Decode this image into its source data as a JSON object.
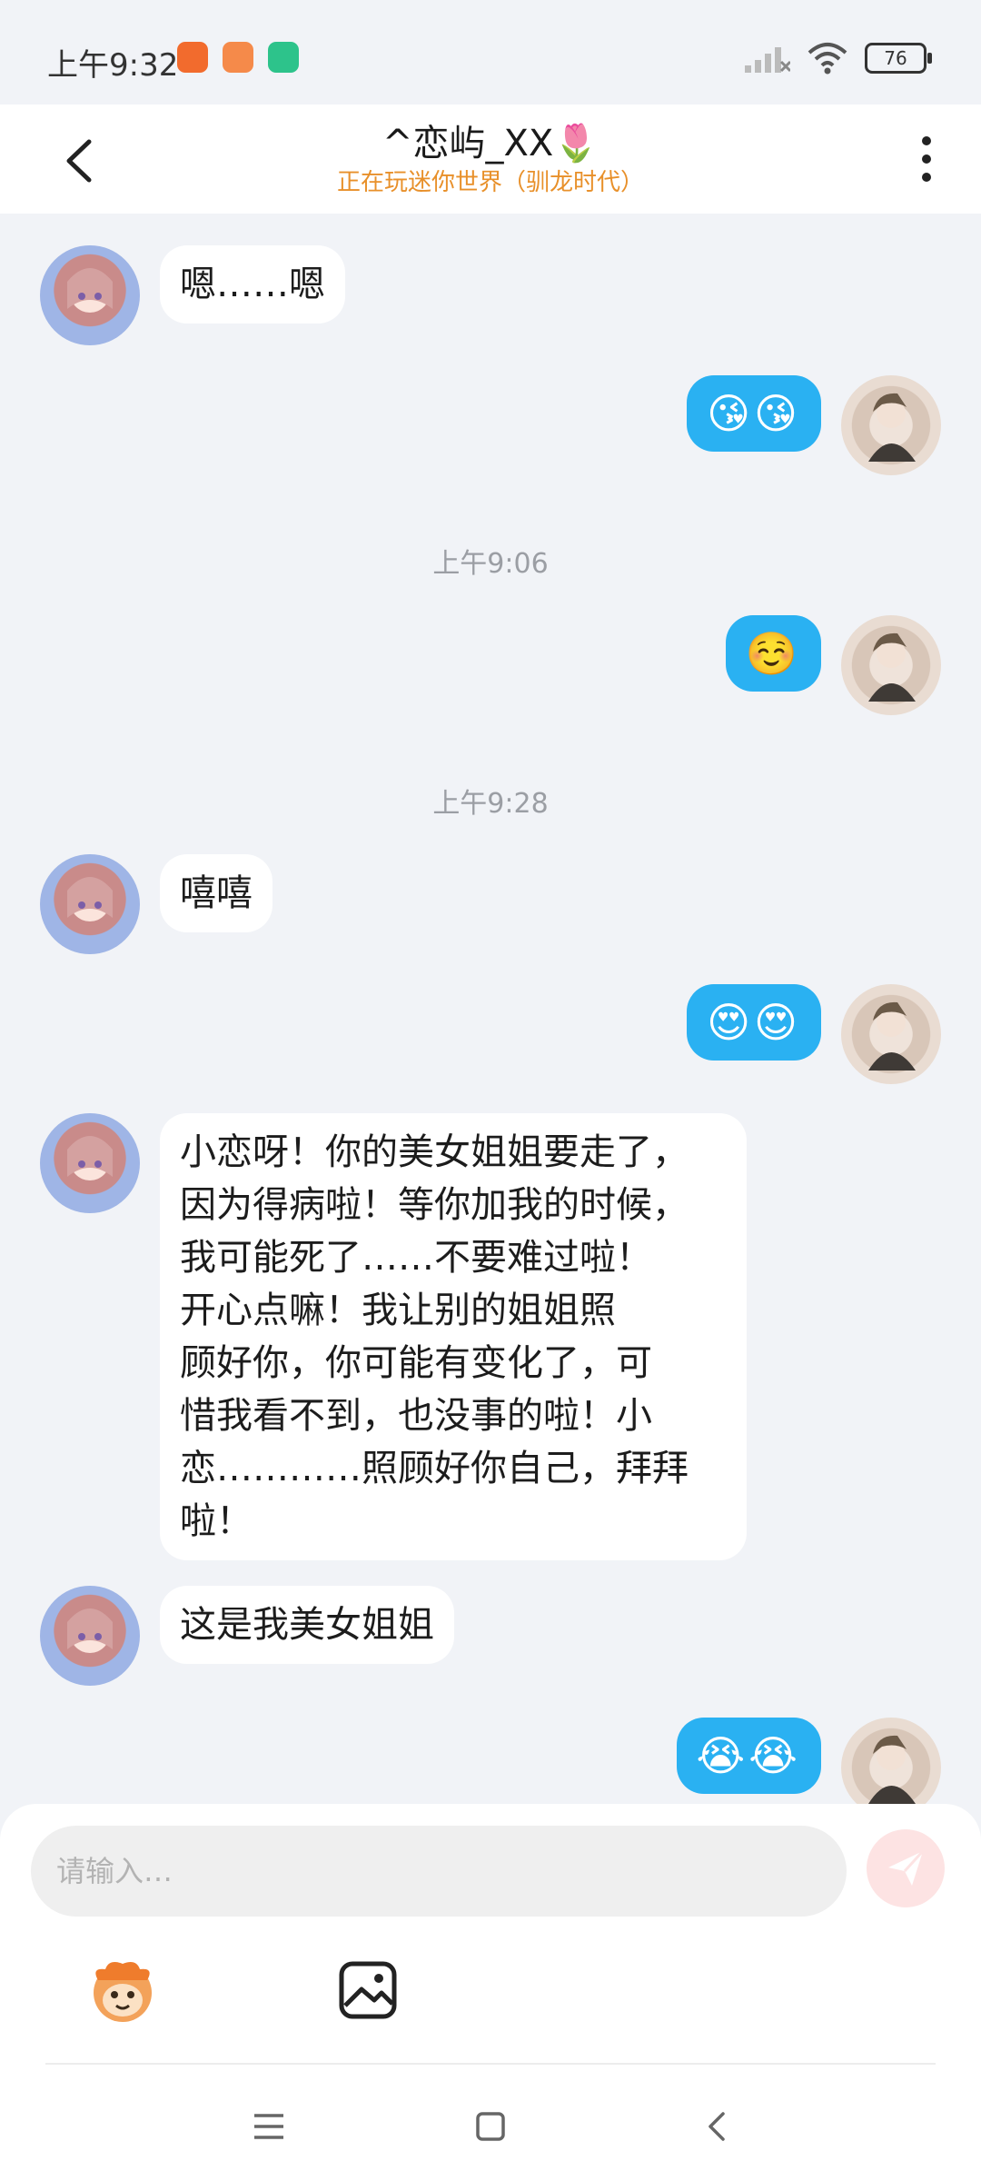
{
  "status_bar": {
    "time": "上午9:32",
    "battery": "76",
    "icons": [
      "app-notification-icon",
      "app-notification-icon",
      "security-shield-icon",
      "signal-icon",
      "wifi-icon",
      "battery-icon"
    ]
  },
  "header": {
    "title": "^恋屿_XX🌷",
    "subtitle": "正在玩迷你世界（驯龙时代）"
  },
  "messages": [
    {
      "side": "in",
      "text": "嗯……嗯"
    },
    {
      "side": "out",
      "text": "😘😘"
    },
    {
      "type": "time",
      "text": "上午9:06"
    },
    {
      "side": "out",
      "text": "☺️"
    },
    {
      "type": "time",
      "text": "上午9:28"
    },
    {
      "side": "in",
      "text": "嘻嘻"
    },
    {
      "side": "out",
      "text": "😍😍"
    },
    {
      "side": "in",
      "lines": [
        "小恋呀！你的美女姐姐要走了，",
        "因为得病啦！等你加我的时候，",
        "我可能死了……不要难过啦！",
        "开心点嘛！我让别的姐姐照",
        "顾好你，你可能有变化了，可",
        "惜我看不到，也没事的啦！小",
        "恋…………照顾好你自己，拜拜",
        "啦！"
      ]
    },
    {
      "side": "in",
      "text": "这是我美女姐姐"
    },
    {
      "side": "out",
      "text": "😭😭"
    }
  ],
  "composer": {
    "placeholder": "请输入…"
  },
  "colors": {
    "accent_blue": "#2ab1f2",
    "subtitle_orange": "#e8902a",
    "send_button_bg": "#fde3e3"
  }
}
